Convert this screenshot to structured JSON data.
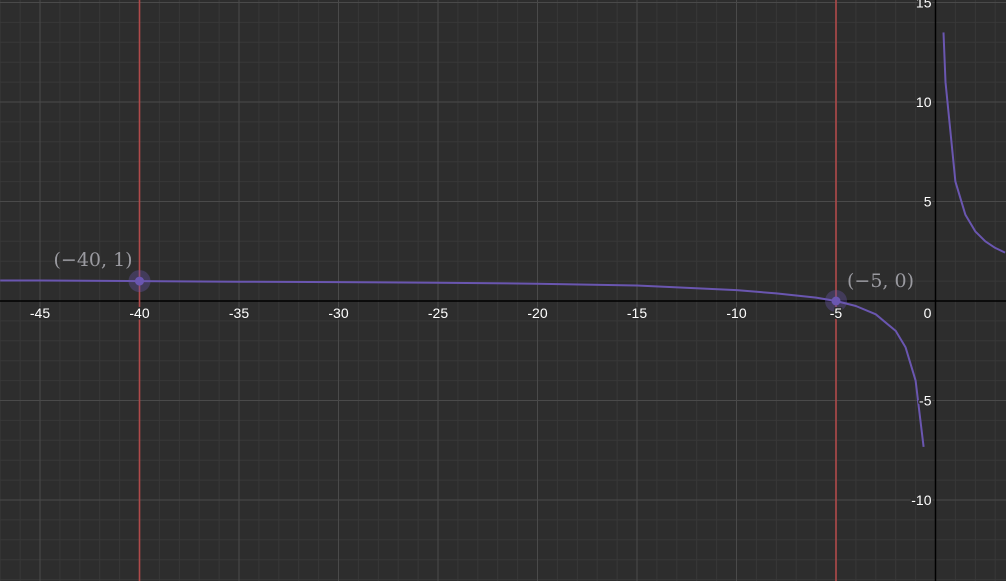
{
  "chart_data": {
    "type": "line",
    "title": "",
    "xlabel": "",
    "ylabel": "",
    "xlim": [
      -47,
      3.5
    ],
    "ylim": [
      -14,
      15
    ],
    "grid": true,
    "x_ticks": [
      -45,
      -40,
      -35,
      -30,
      -25,
      -20,
      -15,
      -10,
      -5,
      0
    ],
    "y_ticks": [
      15,
      10,
      5,
      -5,
      -10
    ],
    "x_tick_labels": [
      "-45",
      "-40",
      "-35",
      "-30",
      "-25",
      "-20",
      "-15",
      "-10",
      "-5",
      "0"
    ],
    "y_tick_labels": [
      "15",
      "10",
      "5",
      "-5",
      "-10"
    ],
    "series": [
      {
        "x": [
          -47,
          -45,
          -40,
          -35,
          -30,
          -25,
          -20,
          -15,
          -10,
          -8,
          -6,
          -5,
          -4,
          -3,
          -2,
          -1.5,
          -1,
          -0.6,
          0.4,
          0.5,
          1,
          1.5,
          2,
          2.5,
          3,
          3.5
        ],
        "y": [
          1.03,
          1.03,
          1.0,
          0.97,
          0.95,
          0.92,
          0.87,
          0.78,
          0.55,
          0.38,
          0.17,
          0.0,
          -0.25,
          -0.67,
          -1.5,
          -2.33,
          -4.0,
          -7.33,
          13.5,
          11.0,
          6.0,
          4.33,
          3.5,
          3.0,
          2.67,
          2.43
        ],
        "color": "#6a56b0"
      }
    ],
    "vertical_lines": [
      {
        "x": -40,
        "color": "#b04a4a"
      },
      {
        "x": -5,
        "color": "#b04a4a"
      }
    ],
    "points": [
      {
        "x": -40,
        "y": 1,
        "label": "(−40, 1)"
      },
      {
        "x": -5,
        "y": 0,
        "label": "(−5, 0)"
      }
    ]
  }
}
